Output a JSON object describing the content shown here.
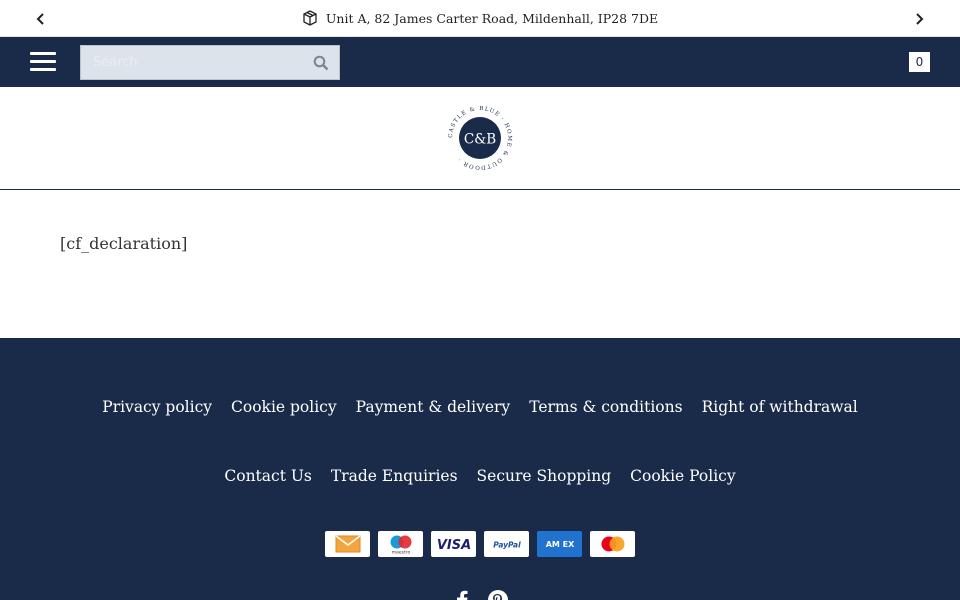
{
  "announcement": {
    "text": "Unit A, 82 James Carter Road, Mildenhall, IP28 7DE",
    "icon": "package-icon"
  },
  "header": {
    "search_placeholder": "Search",
    "cart_count": "0",
    "colors": {
      "navy": "#1a2b4a"
    }
  },
  "logo": {
    "initials": "C&B",
    "ring_text": "CASTLE & BLUE · HOME & OUTDOOR ·"
  },
  "content": {
    "shortcode": "[cf_declaration]"
  },
  "footer": {
    "links_row1": [
      "Privacy policy",
      "Cookie policy",
      "Payment & delivery",
      "Terms & conditions",
      "Right of withdrawal"
    ],
    "links_row2": [
      "Contact Us",
      "Trade Enquiries",
      "Secure Shopping",
      "Cookie Policy"
    ],
    "payment_methods": [
      "invoice",
      "maestro",
      "visa",
      "paypal",
      "amex",
      "mastercard"
    ],
    "payment_labels": {
      "visa": "VISA",
      "paypal": "PayPal",
      "amex": "AM EX",
      "maestro": "maestro"
    },
    "social": [
      "facebook-icon",
      "pinterest-icon"
    ]
  }
}
